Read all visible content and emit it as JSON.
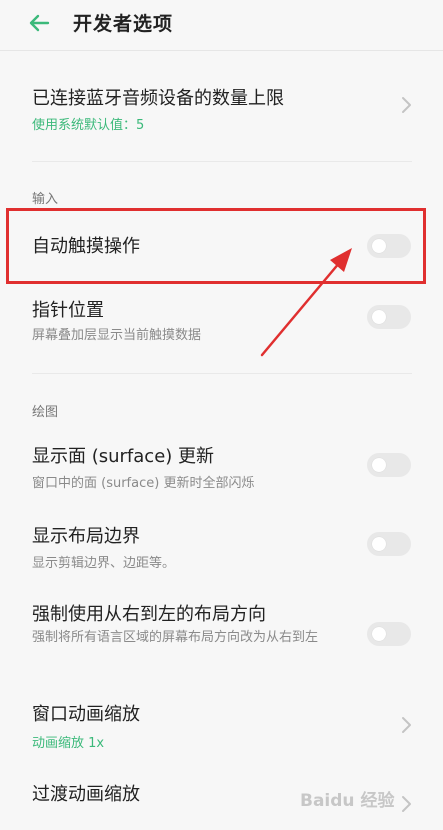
{
  "header": {
    "title": "开发者选项",
    "back_icon": "arrow-left-icon",
    "accent_color": "#3bb97a"
  },
  "rows": {
    "bluetooth": {
      "title": "已连接蓝牙音频设备的数量上限",
      "value": "使用系统默认值：5"
    },
    "input_section": "输入",
    "auto_touch": {
      "title": "自动触摸操作",
      "enabled": false
    },
    "pointer": {
      "title": "指针位置",
      "subtitle": "屏幕叠加层显示当前触摸数据",
      "enabled": false
    },
    "drawing_section": "绘图",
    "surface_updates": {
      "title": "显示面 (surface) 更新",
      "subtitle": "窗口中的面 (surface) 更新时全部闪烁",
      "enabled": false
    },
    "layout_bounds": {
      "title": "显示布局边界",
      "subtitle": "显示剪辑边界、边距等。",
      "enabled": false
    },
    "force_rtl": {
      "title": "强制使用从右到左的布局方向",
      "subtitle": "强制将所有语言区域的屏幕布局方向改为从右到左",
      "enabled": false
    },
    "window_anim": {
      "title": "窗口动画缩放",
      "value": "动画缩放 1x"
    },
    "transition_anim": {
      "title": "过渡动画缩放"
    }
  },
  "annotation": {
    "highlight_color": "#e02f2f"
  },
  "watermark": "Baidu 经验"
}
